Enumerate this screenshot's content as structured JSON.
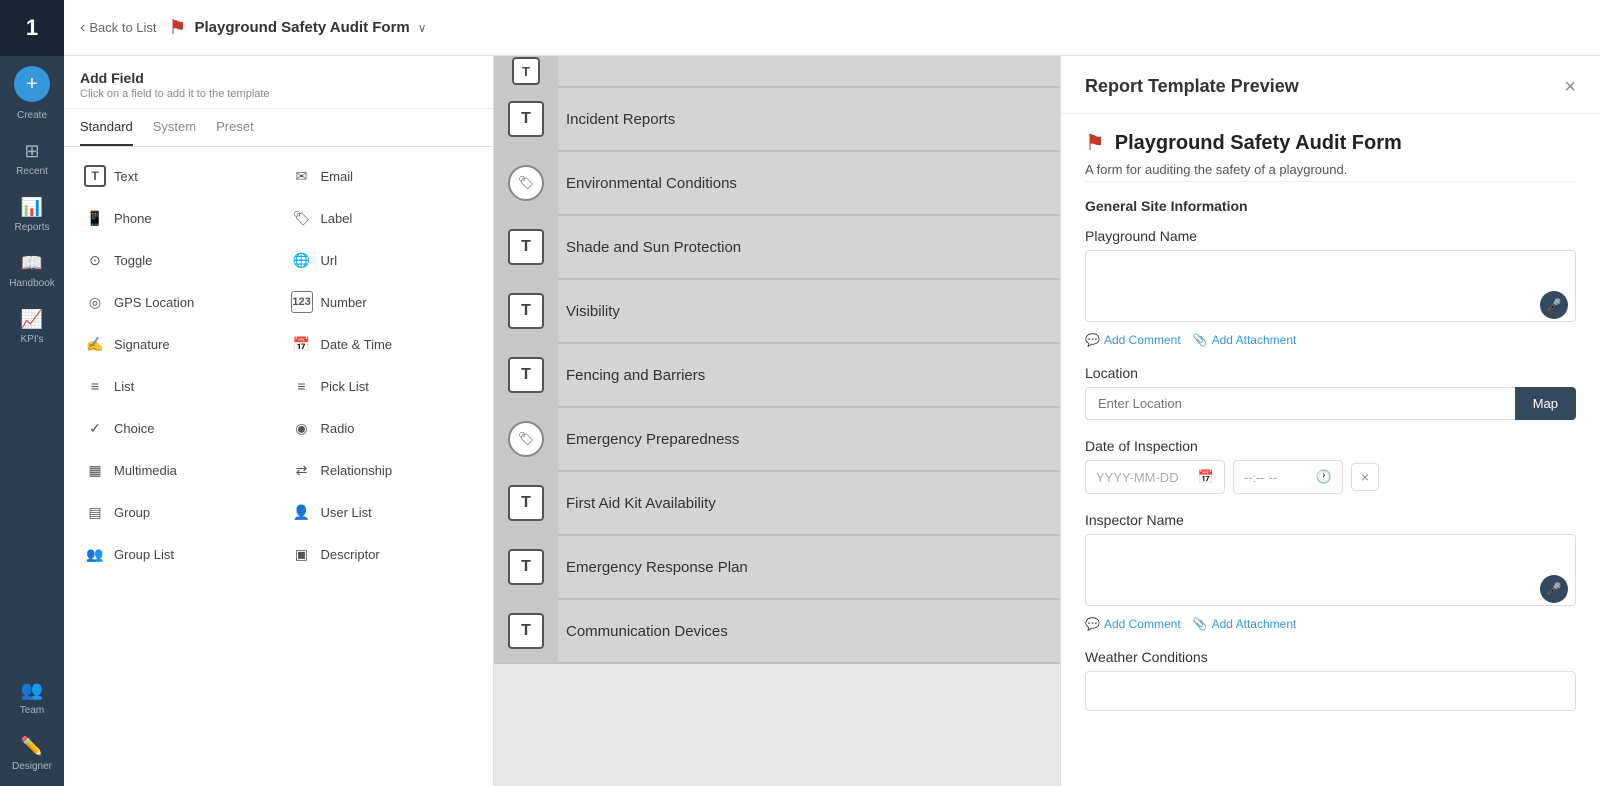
{
  "nav": {
    "logo": "1",
    "items": [
      {
        "id": "create",
        "label": "Create",
        "icon": "+"
      },
      {
        "id": "recent",
        "label": "Recent",
        "icon": "⊞"
      },
      {
        "id": "reports",
        "label": "Reports",
        "icon": "📊"
      },
      {
        "id": "handbook",
        "label": "Handbook",
        "icon": "📖"
      },
      {
        "id": "kpis",
        "label": "KPI's",
        "icon": "📈"
      },
      {
        "id": "team",
        "label": "Team",
        "icon": "👥"
      },
      {
        "id": "designer",
        "label": "Designer",
        "icon": "✏️"
      }
    ]
  },
  "topbar": {
    "back_label": "Back to List",
    "form_title": "Playground Safety Audit Form",
    "chevron": "∨"
  },
  "fields_panel": {
    "title": "Add Field",
    "subtitle": "Click on a field to add it to the template",
    "tabs": [
      "Standard",
      "System",
      "Preset"
    ],
    "active_tab": "Standard",
    "fields": [
      {
        "id": "text",
        "label": "Text",
        "icon": "T"
      },
      {
        "id": "email",
        "label": "Email",
        "icon": "✉"
      },
      {
        "id": "phone",
        "label": "Phone",
        "icon": "📱"
      },
      {
        "id": "label",
        "label": "Label",
        "icon": "🏷"
      },
      {
        "id": "toggle",
        "label": "Toggle",
        "icon": "⊙"
      },
      {
        "id": "url",
        "label": "Url",
        "icon": "🌐"
      },
      {
        "id": "gps",
        "label": "GPS Location",
        "icon": "◎"
      },
      {
        "id": "number",
        "label": "Number",
        "icon": "123"
      },
      {
        "id": "signature",
        "label": "Signature",
        "icon": "✍"
      },
      {
        "id": "datetime",
        "label": "Date & Time",
        "icon": "📅"
      },
      {
        "id": "list",
        "label": "List",
        "icon": "≡"
      },
      {
        "id": "picklist",
        "label": "Pick List",
        "icon": "≡"
      },
      {
        "id": "choice",
        "label": "Choice",
        "icon": "✓"
      },
      {
        "id": "radio",
        "label": "Radio",
        "icon": "◉"
      },
      {
        "id": "multimedia",
        "label": "Multimedia",
        "icon": "▦"
      },
      {
        "id": "relationship",
        "label": "Relationship",
        "icon": "⇄"
      },
      {
        "id": "group",
        "label": "Group",
        "icon": "▤"
      },
      {
        "id": "userlist",
        "label": "User List",
        "icon": "👤"
      },
      {
        "id": "grouplist",
        "label": "Group List",
        "icon": "👥"
      },
      {
        "id": "descriptor",
        "label": "Descriptor",
        "icon": "▣"
      }
    ]
  },
  "form_items": [
    {
      "id": "incident-reports",
      "label": "Incident Reports",
      "icon_type": "T"
    },
    {
      "id": "environmental",
      "label": "Environmental Conditions",
      "icon_type": "label"
    },
    {
      "id": "shade",
      "label": "Shade and Sun Protection",
      "icon_type": "T"
    },
    {
      "id": "visibility",
      "label": "Visibility",
      "icon_type": "T"
    },
    {
      "id": "fencing",
      "label": "Fencing and Barriers",
      "icon_type": "T"
    },
    {
      "id": "emergency",
      "label": "Emergency Preparedness",
      "icon_type": "label"
    },
    {
      "id": "firstaid",
      "label": "First Aid Kit Availability",
      "icon_type": "T"
    },
    {
      "id": "response",
      "label": "Emergency Response Plan",
      "icon_type": "T"
    },
    {
      "id": "communication",
      "label": "Communication Devices",
      "icon_type": "T"
    }
  ],
  "preview": {
    "title": "Report Template Preview",
    "close_icon": "×",
    "form_name": "Playground Safety Audit Form",
    "form_desc": "A form for auditing the safety of a playground.",
    "section_title": "General Site Information",
    "fields": [
      {
        "id": "playground-name",
        "label": "Playground Name",
        "type": "textarea",
        "placeholder": ""
      },
      {
        "id": "location",
        "label": "Location",
        "type": "location",
        "placeholder": "Enter Location"
      },
      {
        "id": "inspection-date",
        "label": "Date of Inspection",
        "type": "datetime",
        "date_placeholder": "YYYY-MM-DD",
        "time_placeholder": "--:-- --"
      },
      {
        "id": "inspector-name",
        "label": "Inspector Name",
        "type": "textarea",
        "placeholder": ""
      },
      {
        "id": "weather",
        "label": "Weather Conditions",
        "type": "textarea",
        "placeholder": ""
      }
    ],
    "add_comment_label": "Add Comment",
    "add_attachment_label": "Add Attachment",
    "map_button_label": "Map"
  }
}
